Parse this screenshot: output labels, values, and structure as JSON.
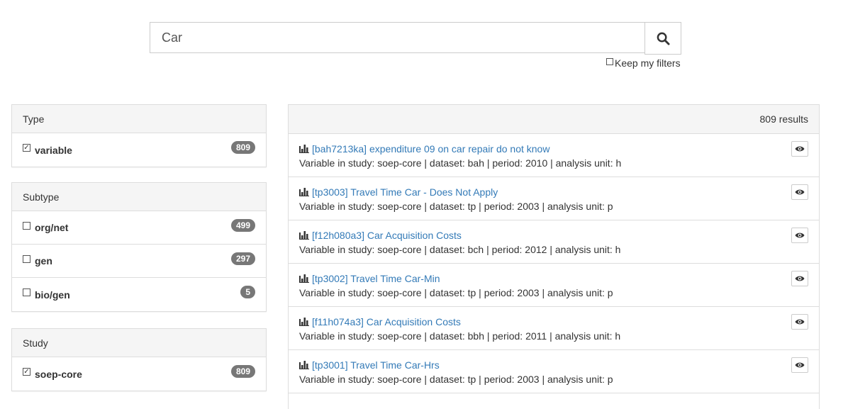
{
  "search": {
    "value": "Car",
    "keep_filters_label": "Keep my filters"
  },
  "facets": [
    {
      "title": "Type",
      "items": [
        {
          "label": "variable",
          "count": "809",
          "checked": true
        }
      ]
    },
    {
      "title": "Subtype",
      "items": [
        {
          "label": "org/net",
          "count": "499",
          "checked": false
        },
        {
          "label": "gen",
          "count": "297",
          "checked": false
        },
        {
          "label": "bio/gen",
          "count": "5",
          "checked": false
        }
      ]
    },
    {
      "title": "Study",
      "items": [
        {
          "label": "soep-core",
          "count": "809",
          "checked": true
        }
      ]
    }
  ],
  "results": {
    "count_label": "809 results",
    "items": [
      {
        "title": "[bah7213ka] expenditure 09 on car repair do not know",
        "desc": "Variable in study: soep-core | dataset: bah | period: 2010 | analysis unit: h"
      },
      {
        "title": "[tp3003] Travel Time Car - Does Not Apply",
        "desc": "Variable in study: soep-core | dataset: tp | period: 2003 | analysis unit: p"
      },
      {
        "title": "[f12h080a3] Car Acquisition Costs",
        "desc": "Variable in study: soep-core | dataset: bch | period: 2012 | analysis unit: h"
      },
      {
        "title": "[tp3002] Travel Time Car-Min",
        "desc": "Variable in study: soep-core | dataset: tp | period: 2003 | analysis unit: p"
      },
      {
        "title": "[f11h074a3] Car Acquisition Costs",
        "desc": "Variable in study: soep-core | dataset: bbh | period: 2011 | analysis unit: h"
      },
      {
        "title": "[tp3001] Travel Time Car-Hrs",
        "desc": "Variable in study: soep-core | dataset: tp | period: 2003 | analysis unit: p"
      }
    ]
  },
  "icons": {
    "search": "search-icon",
    "bar_chart": "bar-chart-icon",
    "eye": "eye-icon"
  },
  "colors": {
    "link": "#337ab7",
    "badge": "#777777",
    "panel_header": "#f5f5f5"
  }
}
